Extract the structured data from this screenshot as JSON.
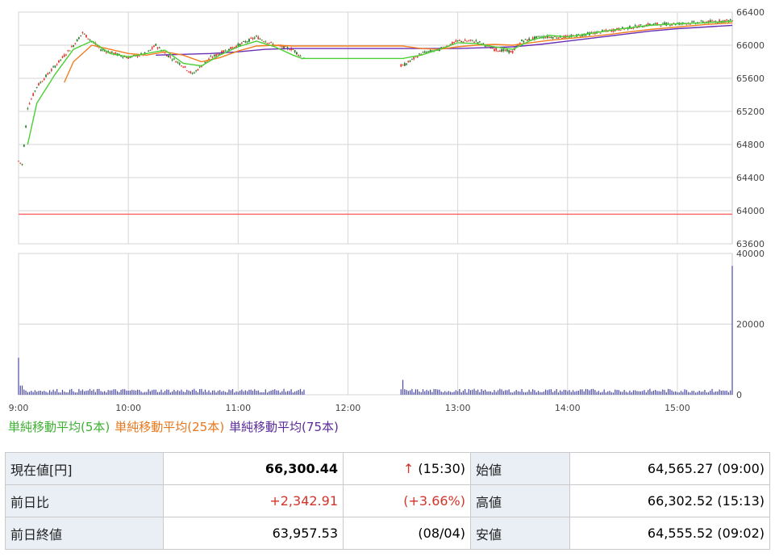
{
  "chart_data": [
    {
      "type": "candlestick",
      "panel": "price",
      "ylim": [
        63600,
        66400
      ],
      "yticks": [
        "66400",
        "66000",
        "65600",
        "65200",
        "64800",
        "64400",
        "64000",
        "63600"
      ],
      "reference_line": {
        "value": 63957.53,
        "color": "#ff6b6b"
      },
      "series_colors": {
        "ma5": "#4bd033",
        "ma25": "#f07d1e",
        "ma75": "#6a2fb5",
        "up": "#e03c31",
        "down": "#2a7a2a"
      },
      "ohlc_anchors": [
        [
          "9:00",
          64600
        ],
        [
          "9:02",
          64560
        ],
        [
          "9:05",
          65250
        ],
        [
          "9:10",
          65500
        ],
        [
          "9:20",
          65750
        ],
        [
          "9:30",
          66000
        ],
        [
          "9:35",
          66150
        ],
        [
          "9:45",
          65950
        ],
        [
          "9:55",
          65880
        ],
        [
          "10:00",
          65850
        ],
        [
          "10:10",
          65900
        ],
        [
          "10:15",
          66000
        ],
        [
          "10:20",
          65900
        ],
        [
          "10:30",
          65750
        ],
        [
          "10:35",
          65650
        ],
        [
          "10:45",
          65850
        ],
        [
          "11:00",
          66000
        ],
        [
          "11:10",
          66100
        ],
        [
          "11:20",
          66000
        ],
        [
          "11:30",
          65950
        ],
        [
          "11:35",
          65850
        ],
        [
          "12:30",
          65750
        ],
        [
          "12:40",
          65900
        ],
        [
          "12:50",
          65950
        ],
        [
          "13:00",
          66050
        ],
        [
          "13:10",
          66050
        ],
        [
          "13:20",
          65950
        ],
        [
          "13:30",
          65920
        ],
        [
          "13:35",
          66050
        ],
        [
          "13:45",
          66100
        ],
        [
          "14:00",
          66100
        ],
        [
          "14:15",
          66150
        ],
        [
          "14:30",
          66200
        ],
        [
          "14:45",
          66250
        ],
        [
          "15:00",
          66260
        ],
        [
          "15:15",
          66280
        ],
        [
          "15:30",
          66300
        ]
      ],
      "ma5": [
        [
          "9:05",
          64800
        ],
        [
          "9:10",
          65300
        ],
        [
          "9:20",
          65650
        ],
        [
          "9:30",
          65950
        ],
        [
          "9:40",
          66050
        ],
        [
          "9:50",
          65900
        ],
        [
          "10:00",
          65860
        ],
        [
          "10:10",
          65900
        ],
        [
          "10:20",
          65940
        ],
        [
          "10:30",
          65780
        ],
        [
          "10:40",
          65750
        ],
        [
          "10:50",
          65880
        ],
        [
          "11:00",
          65980
        ],
        [
          "11:10",
          66050
        ],
        [
          "11:20",
          65980
        ],
        [
          "11:30",
          65880
        ],
        [
          "11:35",
          65840
        ],
        [
          "12:30",
          65840
        ],
        [
          "12:40",
          65880
        ],
        [
          "12:50",
          65950
        ],
        [
          "13:00",
          66030
        ],
        [
          "13:10",
          66020
        ],
        [
          "13:20",
          65980
        ],
        [
          "13:30",
          65950
        ],
        [
          "13:40",
          66060
        ],
        [
          "13:50",
          66120
        ],
        [
          "14:00",
          66100
        ],
        [
          "14:15",
          66150
        ],
        [
          "14:30",
          66200
        ],
        [
          "14:45",
          66240
        ],
        [
          "15:00",
          66260
        ],
        [
          "15:15",
          66270
        ],
        [
          "15:30",
          66290
        ]
      ],
      "ma25": [
        [
          "9:25",
          65550
        ],
        [
          "9:30",
          65800
        ],
        [
          "9:40",
          66000
        ],
        [
          "9:50",
          65950
        ],
        [
          "10:00",
          65900
        ],
        [
          "10:10",
          65880
        ],
        [
          "10:20",
          65920
        ],
        [
          "10:30",
          65880
        ],
        [
          "10:40",
          65800
        ],
        [
          "10:50",
          65850
        ],
        [
          "11:00",
          65930
        ],
        [
          "11:10",
          65990
        ],
        [
          "11:20",
          66000
        ],
        [
          "11:30",
          65990
        ],
        [
          "12:30",
          65990
        ],
        [
          "12:40",
          65960
        ],
        [
          "12:50",
          65950
        ],
        [
          "13:00",
          65980
        ],
        [
          "13:10",
          66000
        ],
        [
          "13:20",
          66010
        ],
        [
          "13:30",
          66000
        ],
        [
          "13:40",
          66030
        ],
        [
          "13:50",
          66060
        ],
        [
          "14:00",
          66080
        ],
        [
          "14:15",
          66110
        ],
        [
          "14:30",
          66150
        ],
        [
          "14:45",
          66190
        ],
        [
          "15:00",
          66220
        ],
        [
          "15:15",
          66250
        ],
        [
          "15:30",
          66270
        ]
      ],
      "ma75": [
        [
          "10:15",
          65880
        ],
        [
          "10:30",
          65890
        ],
        [
          "10:45",
          65900
        ],
        [
          "11:00",
          65920
        ],
        [
          "11:15",
          65950
        ],
        [
          "11:30",
          65960
        ],
        [
          "12:30",
          65960
        ],
        [
          "12:45",
          65960
        ],
        [
          "13:00",
          65960
        ],
        [
          "13:15",
          65970
        ],
        [
          "13:30",
          65980
        ],
        [
          "13:45",
          66010
        ],
        [
          "14:00",
          66050
        ],
        [
          "14:15",
          66090
        ],
        [
          "14:30",
          66130
        ],
        [
          "14:45",
          66170
        ],
        [
          "15:00",
          66200
        ],
        [
          "15:15",
          66220
        ],
        [
          "15:30",
          66240
        ]
      ]
    },
    {
      "type": "bar",
      "panel": "volume",
      "ylim": [
        0,
        40000
      ],
      "yticks": [
        "40000",
        "20000",
        "0"
      ],
      "color": "#4a4aa5",
      "spikes": [
        [
          "9:00",
          10500
        ],
        [
          "12:30",
          4200
        ],
        [
          "15:30",
          36500
        ]
      ],
      "base_level": 1200,
      "xticks": [
        "9:00",
        "10:00",
        "11:00",
        "12:00",
        "13:00",
        "14:00",
        "15:00"
      ]
    }
  ],
  "legend": [
    {
      "label": "単純移動平均(5本)",
      "color": "#3cb030"
    },
    {
      "label": "単純移動平均(25本)",
      "color": "#e8761a"
    },
    {
      "label": "単純移動平均(75本)",
      "color": "#5a2a9a"
    }
  ],
  "quote": {
    "current_label": "現在値[円]",
    "current_value": "66,300.44",
    "current_arrow": "↑",
    "current_time": "(15:30)",
    "open_label": "始値",
    "open_value": "64,565.27 (09:00)",
    "change_label": "前日比",
    "change_value": "+2,342.91",
    "change_pct": "(+3.66%)",
    "high_label": "高値",
    "high_value": "66,302.52 (15:13)",
    "prev_close_label": "前日終値",
    "prev_close_value": "63,957.53",
    "prev_close_date": "(08/04)",
    "low_label": "安値",
    "low_value": "64,555.52 (09:02)"
  }
}
